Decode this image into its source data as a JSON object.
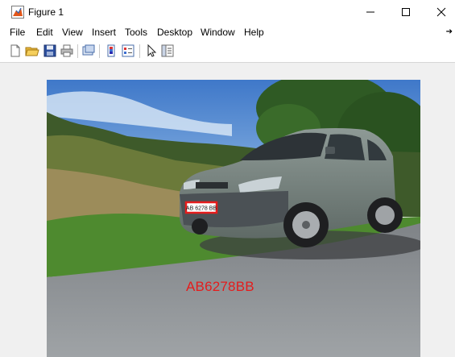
{
  "window": {
    "title": "Figure 1",
    "icon": "matlab-figure-icon"
  },
  "menu": {
    "items": [
      "File",
      "Edit",
      "View",
      "Insert",
      "Tools",
      "Desktop",
      "Window",
      "Help"
    ]
  },
  "toolbar": {
    "icons": [
      "new-figure-icon",
      "open-file-icon",
      "save-icon",
      "print-icon",
      "link-plot-icon",
      "insert-colorbar-icon",
      "insert-legend-icon",
      "pointer-icon",
      "property-inspector-icon"
    ]
  },
  "figure": {
    "plate_on_car": "AB 6278 BB",
    "detected_plate_text": "AB6278BB",
    "box_color": "#e51c1c"
  }
}
